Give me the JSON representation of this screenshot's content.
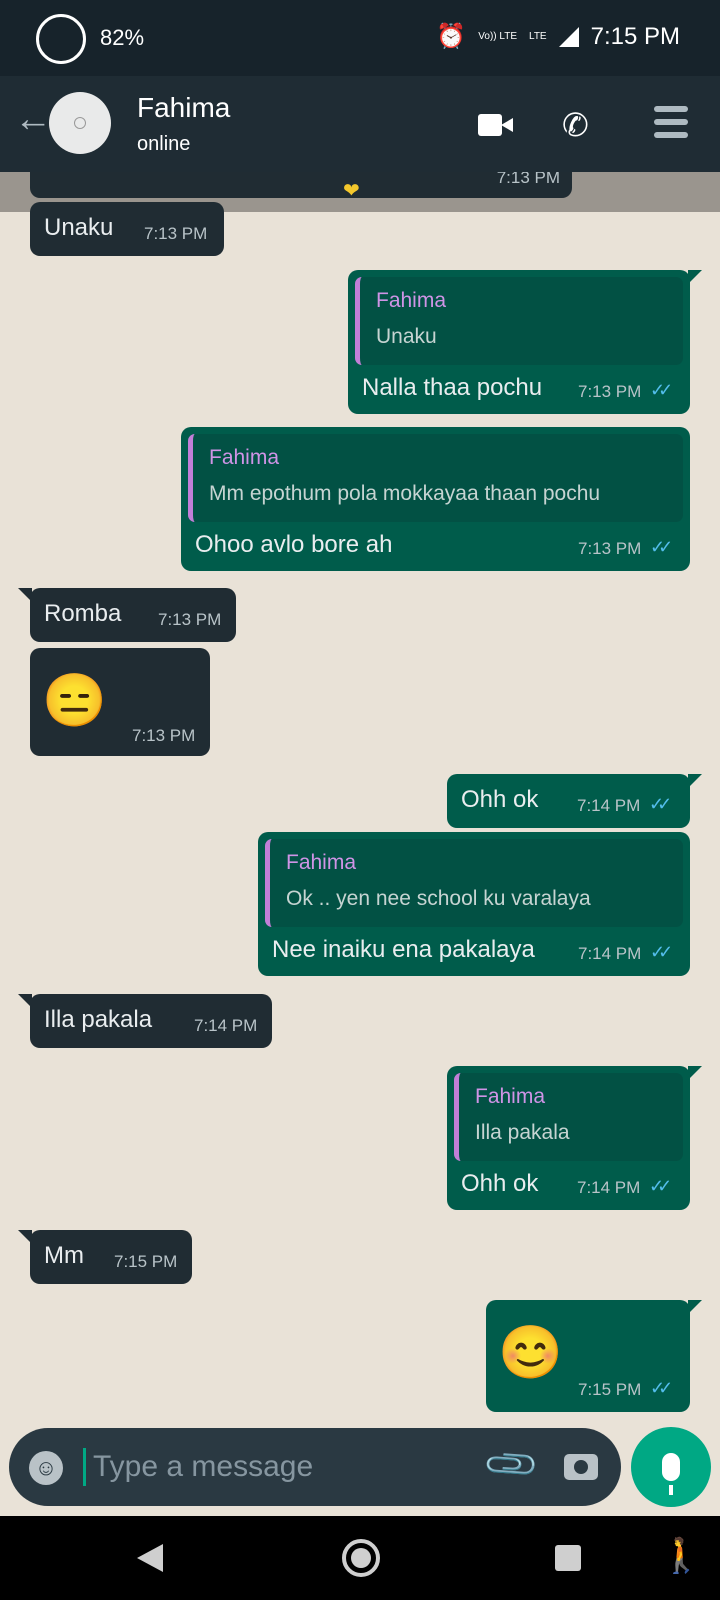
{
  "status_bar": {
    "battery": "82%",
    "network_top": "Vo)) LTE",
    "network_small": "LTE",
    "time": "7:15 PM"
  },
  "header": {
    "contact_name": "Fahima",
    "contact_status": "online"
  },
  "chat": {
    "partial_time": "7:13 PM",
    "messages": [
      {
        "dir": "in",
        "text": "Unaku",
        "time": "7:13 PM"
      },
      {
        "dir": "out",
        "quote_name": "Fahima",
        "quote_text": "Unaku",
        "text": "Nalla thaa pochu",
        "time": "7:13 PM"
      },
      {
        "dir": "out",
        "quote_name": "Fahima",
        "quote_text": "Mm epothum pola  mokkayaa thaan pochu",
        "text": "Ohoo avlo bore ah",
        "time": "7:13 PM"
      },
      {
        "dir": "in",
        "text": "Romba",
        "time": "7:13 PM"
      },
      {
        "dir": "in",
        "emoji": "😑",
        "time": "7:13 PM"
      },
      {
        "dir": "out",
        "text": "Ohh ok",
        "time": "7:14 PM"
      },
      {
        "dir": "out",
        "quote_name": "Fahima",
        "quote_text": "Ok .. yen nee school ku varalaya",
        "text": "Nee inaiku ena pakalaya",
        "time": "7:14 PM"
      },
      {
        "dir": "in",
        "text": "Illa pakala",
        "time": "7:14 PM"
      },
      {
        "dir": "out",
        "quote_name": "Fahima",
        "quote_text": "Illa pakala",
        "text": "Ohh ok",
        "time": "7:14 PM"
      },
      {
        "dir": "in",
        "text": "Mm",
        "time": "7:15 PM"
      },
      {
        "dir": "out",
        "emoji": "😊",
        "time": "7:15 PM"
      }
    ]
  },
  "composer": {
    "placeholder": "Type a message"
  },
  "colors": {
    "incoming": "#202c33",
    "outgoing": "#005c4b",
    "accent": "#00a884",
    "read_ticks": "#53bdeb",
    "quote_name": "#cf94e6"
  },
  "icons": [
    "back-arrow-icon",
    "video-call-icon",
    "phone-icon",
    "menu-icon",
    "emoji-icon",
    "attach-icon",
    "camera-icon",
    "mic-icon"
  ]
}
